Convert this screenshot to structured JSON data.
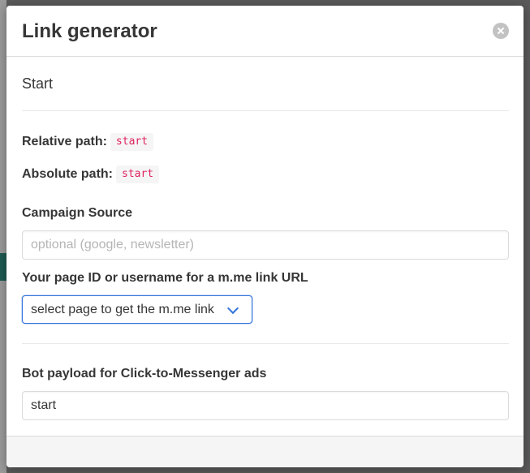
{
  "modal": {
    "title": "Link generator",
    "close_icon": "close-icon"
  },
  "start": {
    "heading": "Start",
    "relative_path_label": "Relative path:",
    "relative_path_value": "start",
    "absolute_path_label": "Absolute path:",
    "absolute_path_value": "start"
  },
  "campaign": {
    "label": "Campaign Source",
    "value": "",
    "placeholder": "optional (google, newsletter)"
  },
  "page_id": {
    "label": "Your page ID or username for a m.me link URL",
    "selected": "select page to get the m.me link",
    "icon": "chevron-down-icon"
  },
  "payload": {
    "label": "Bot payload for Click-to-Messenger ads",
    "value": "start"
  },
  "colors": {
    "code_text": "#e0245e",
    "focus_border": "#3273dc",
    "title_text": "#363636"
  }
}
